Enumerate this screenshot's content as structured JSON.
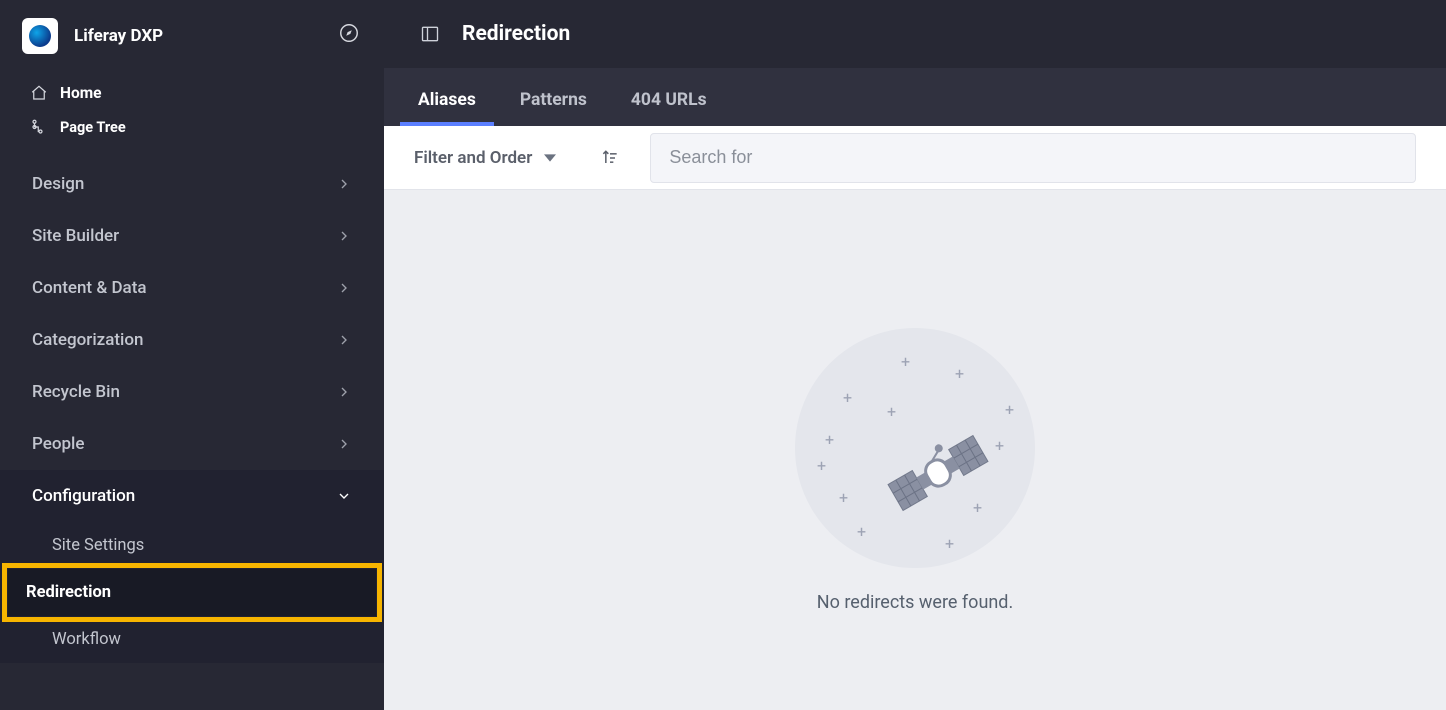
{
  "product": {
    "name": "Liferay DXP"
  },
  "quicklinks": {
    "home": "Home",
    "pageTree": "Page Tree"
  },
  "nav": {
    "items": [
      {
        "label": "Design"
      },
      {
        "label": "Site Builder"
      },
      {
        "label": "Content & Data"
      },
      {
        "label": "Categorization"
      },
      {
        "label": "Recycle Bin"
      },
      {
        "label": "People"
      },
      {
        "label": "Configuration"
      }
    ]
  },
  "subnav": {
    "items": [
      {
        "label": "Site Settings"
      },
      {
        "label": "Redirection"
      },
      {
        "label": "Workflow"
      }
    ]
  },
  "page": {
    "title": "Redirection",
    "tabs": [
      {
        "label": "Aliases"
      },
      {
        "label": "Patterns"
      },
      {
        "label": "404 URLs"
      }
    ],
    "filterLabel": "Filter and Order",
    "searchPlaceholder": "Search for",
    "emptyMessage": "No redirects were found."
  },
  "colors": {
    "accent": "#5b7fff",
    "highlight": "#f7b500",
    "bgDark": "#272834"
  }
}
